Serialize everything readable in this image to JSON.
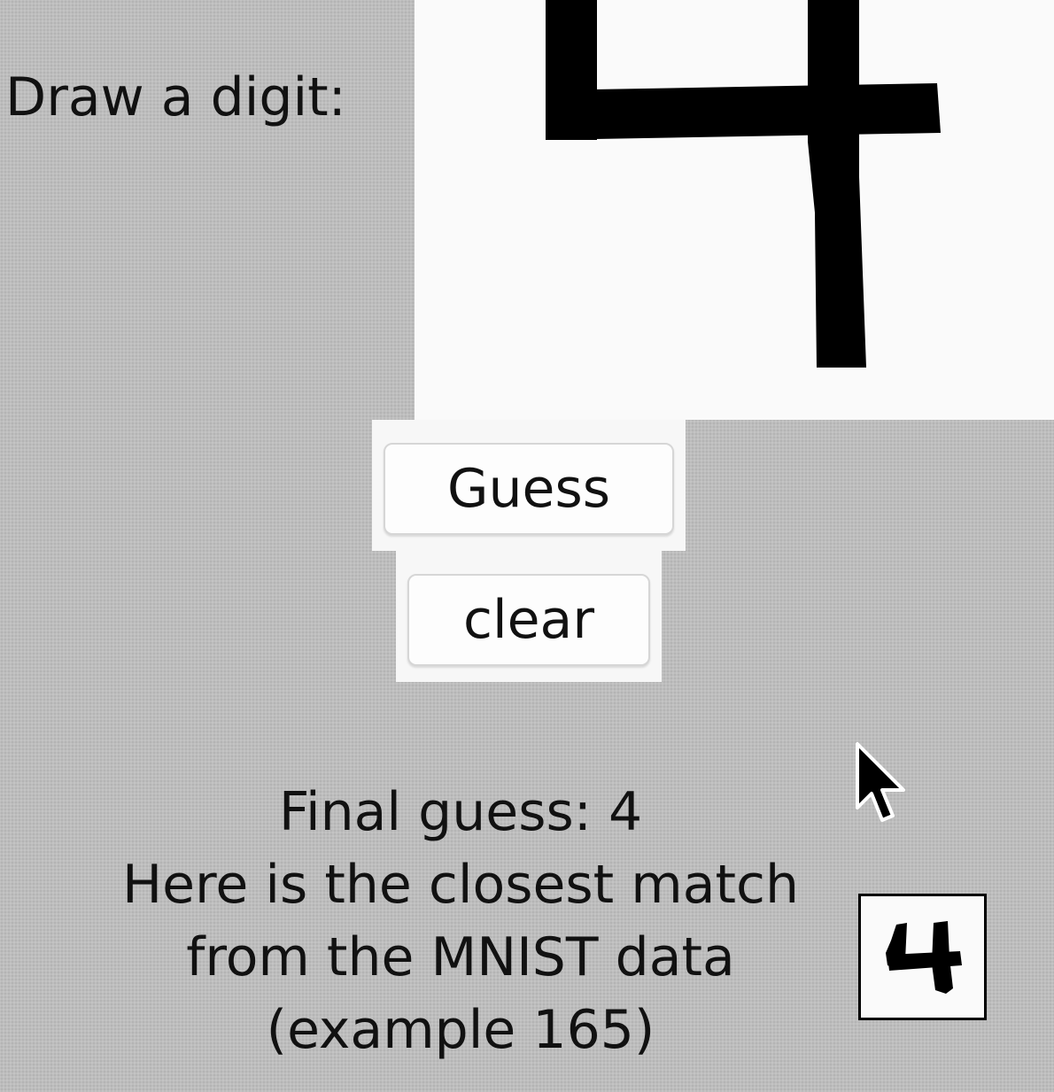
{
  "prompt": {
    "label": "Draw a digit:"
  },
  "buttons": {
    "guess_label": "Guess",
    "clear_label": "clear"
  },
  "result": {
    "final_guess_line": "Final guess: 4",
    "match_line_1": "Here is the closest match",
    "match_line_2": "from the MNIST data",
    "match_line_3": "(example 165)"
  },
  "icons": {
    "cursor": "mouse-pointer-icon"
  },
  "colors": {
    "background": "#bdbdbd",
    "canvas": "#fafafa",
    "ink": "#000000",
    "button_border": "#d6d6d6"
  }
}
